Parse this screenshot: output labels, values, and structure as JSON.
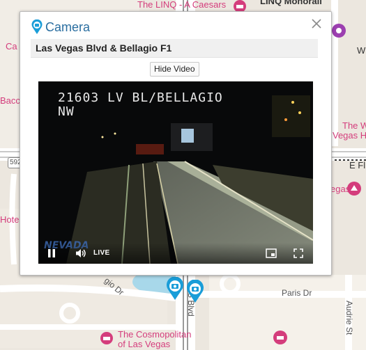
{
  "map": {
    "labels": {
      "linq_caesars": "The LINQ - A Caesars",
      "linq_monorail": "LINQ Monorail",
      "cas_partial": "Ca",
      "bacc_partial": "Bacc",
      "hote_partial": "Hote",
      "the_w": "The W",
      "vegas_h": "Vegas H",
      "vegas_partial": "egas",
      "wi_partial": "Wi",
      "e_fl_partial": "E Fl",
      "route_592": "592",
      "paris_dr": "Paris Dr",
      "audrie_st": "Audrie St",
      "s_blvd": "S Blvd",
      "gio_dr": "gio Dr",
      "cosmopolitan_line1": "The Cosmopolitan",
      "cosmopolitan_line2": "of Las Vegas"
    }
  },
  "popup": {
    "title": "Camera",
    "location": "Las Vegas Blvd & Bellagio F1",
    "hide_video_label": "Hide Video",
    "video": {
      "overlay_line1": "21603 LV BL/BELLAGIO",
      "overlay_line2": "NW",
      "live_label": "LIVE"
    }
  },
  "colors": {
    "title_blue": "#2a6ea0",
    "pink_poi": "#d43d7c",
    "purple_poi": "#9c3fb0",
    "camera_pin": "#1a9dd8"
  },
  "icons": {
    "title": "camera-marker-icon",
    "close": "close-icon",
    "pause": "pause-icon",
    "volume": "volume-icon",
    "pip": "picture-in-picture-icon",
    "fullscreen": "fullscreen-icon"
  }
}
